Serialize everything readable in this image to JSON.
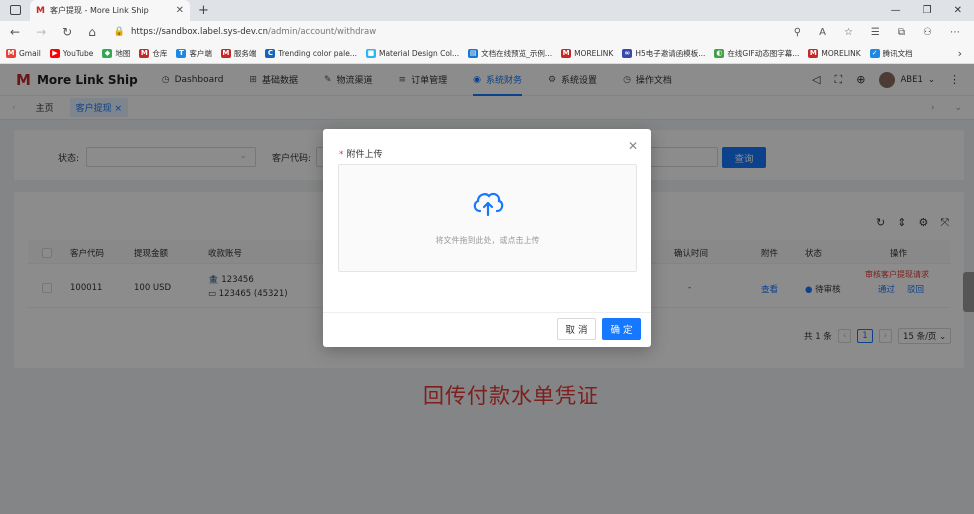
{
  "browser": {
    "tab_title": "客户提现 - More Link Ship",
    "tab_favicon": "M",
    "url_host": "https://sandbox.label.sys-dev.cn",
    "url_path": "/admin/account/withdraw",
    "bookmarks": [
      {
        "label": "Gmail",
        "color": "#ea4335",
        "glyph": "M"
      },
      {
        "label": "YouTube",
        "color": "#ff0000",
        "glyph": "▶"
      },
      {
        "label": "地图",
        "color": "#34a853",
        "glyph": "◆"
      },
      {
        "label": "仓库",
        "color": "#c62828",
        "glyph": "M"
      },
      {
        "label": "客户端",
        "color": "#1e88e5",
        "glyph": "T"
      },
      {
        "label": "服务端",
        "color": "#c62828",
        "glyph": "M"
      },
      {
        "label": "Trending color pale...",
        "color": "#1565c0",
        "glyph": "C"
      },
      {
        "label": "Material Design Col...",
        "color": "#29b6f6",
        "glyph": "■"
      },
      {
        "label": "文档在线预览_示例...",
        "color": "#1976d2",
        "glyph": "▤"
      },
      {
        "label": "MORELINK",
        "color": "#c62828",
        "glyph": "M"
      },
      {
        "label": "H5电子邀请函模板...",
        "color": "#3949ab",
        "glyph": "∞"
      },
      {
        "label": "在线GIF动态图字幕...",
        "color": "#43a047",
        "glyph": "◐"
      },
      {
        "label": "MORELINK",
        "color": "#c62828",
        "glyph": "M"
      },
      {
        "label": "腾讯文档",
        "color": "#1e88e5",
        "glyph": "✓"
      }
    ]
  },
  "app": {
    "logo_text": "More Link Ship",
    "logo_mark": "M",
    "menu": [
      {
        "icon": "dashboard-icon",
        "glyph": "◷",
        "label": "Dashboard",
        "active": false
      },
      {
        "icon": "grid-icon",
        "glyph": "⊞",
        "label": "基础数据",
        "active": false
      },
      {
        "icon": "route-icon",
        "glyph": "✎",
        "label": "物流渠道",
        "active": false
      },
      {
        "icon": "list-icon",
        "glyph": "≡",
        "label": "订单管理",
        "active": false
      },
      {
        "icon": "finance-icon",
        "glyph": "◉",
        "label": "系统财务",
        "active": true
      },
      {
        "icon": "settings-icon",
        "glyph": "⚙",
        "label": "系统设置",
        "active": false
      },
      {
        "icon": "doc-icon",
        "glyph": "◷",
        "label": "操作文档",
        "active": false
      }
    ],
    "user_name": "ABE1"
  },
  "tags": {
    "home": "主页",
    "current": "客户提现",
    "current_close": "×"
  },
  "filter": {
    "status_label": "状态:",
    "customer_code_label": "客户代码:",
    "search_button": "查询"
  },
  "table": {
    "headers": {
      "customer_code": "客户代码",
      "amount": "提现金额",
      "account": "收款账号",
      "confirm_time": "确认时间",
      "attachment": "附件",
      "status": "状态",
      "actions": "操作"
    },
    "row": {
      "customer_code": "100011",
      "amount": "100 USD",
      "account_bank": "123456",
      "account_card": "123465 (45321)",
      "confirm_time": "-",
      "attachment": "查看",
      "status": "待审核",
      "action_note": "审核客户提现请求",
      "approve": "通过",
      "reject": "驳回"
    }
  },
  "pagination": {
    "total": "共 1 条",
    "current_page": "1",
    "page_size": "15 条/页"
  },
  "annotation": "回传付款水单凭证",
  "modal": {
    "field_label": "附件上传",
    "required_mark": "*",
    "upload_hint": "将文件拖到此处，或点击上传",
    "cancel": "取 消",
    "ok": "确 定"
  },
  "colors": {
    "primary": "#1677ff",
    "danger": "#e53935",
    "brand": "#c62828"
  }
}
